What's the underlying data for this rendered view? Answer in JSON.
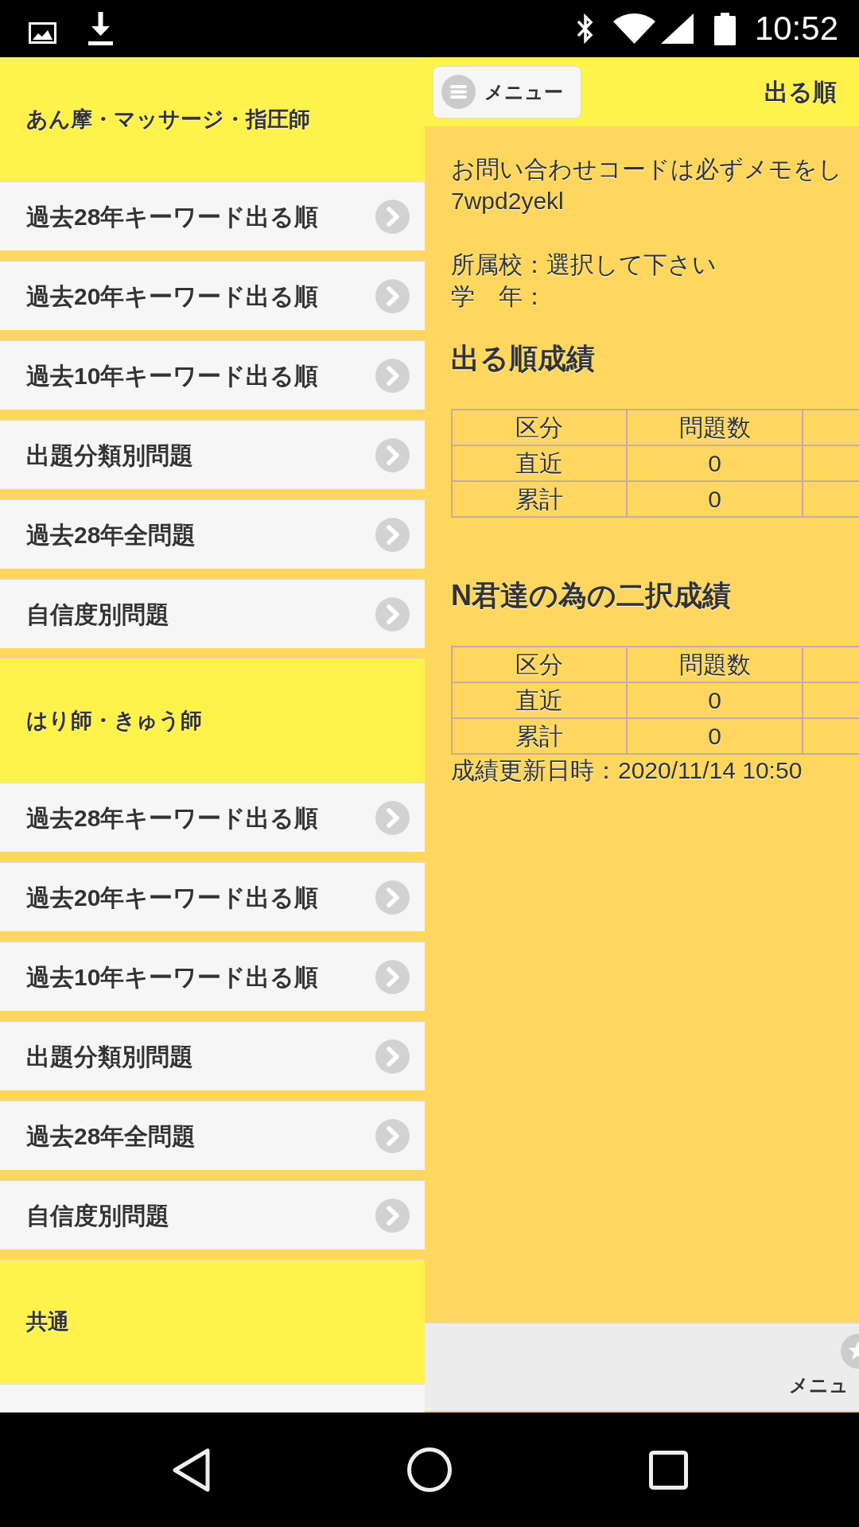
{
  "status_bar": {
    "time": "10:52"
  },
  "sidebar": {
    "sections": [
      {
        "title": "あん摩・マッサージ・指圧師",
        "items": [
          "過去28年キーワード出る順",
          "過去20年キーワード出る順",
          "過去10年キーワード出る順",
          "出題分類別問題",
          "過去28年全問題",
          "自信度別問題"
        ]
      },
      {
        "title": "はり師・きゅう師",
        "items": [
          "過去28年キーワード出る順",
          "過去20年キーワード出る順",
          "過去10年キーワード出る順",
          "出題分類別問題",
          "過去28年全問題",
          "自信度別問題"
        ]
      },
      {
        "title": "共通"
      }
    ]
  },
  "header": {
    "menu_button": "メニュー",
    "title": "出る順"
  },
  "content": {
    "notice": "お問い合わせコードは必ずメモをし",
    "code": "7wpd2yekl",
    "school": "所属校：選択して下さい",
    "grade": "学　年：",
    "score_sections": [
      {
        "heading": "出る順成績",
        "table": {
          "columns": [
            "区分",
            "問題数"
          ],
          "rows": [
            [
              "直近",
              "0"
            ],
            [
              "累計",
              "0"
            ]
          ]
        }
      },
      {
        "heading": "N君達の為の二択成績",
        "table": {
          "columns": [
            "区分",
            "問題数"
          ],
          "rows": [
            [
              "直近",
              "0"
            ],
            [
              "累計",
              "0"
            ]
          ]
        }
      }
    ],
    "updated": "成績更新日時：2020/11/14 10:50"
  },
  "footer": {
    "menu_tab": "メニュ"
  }
}
